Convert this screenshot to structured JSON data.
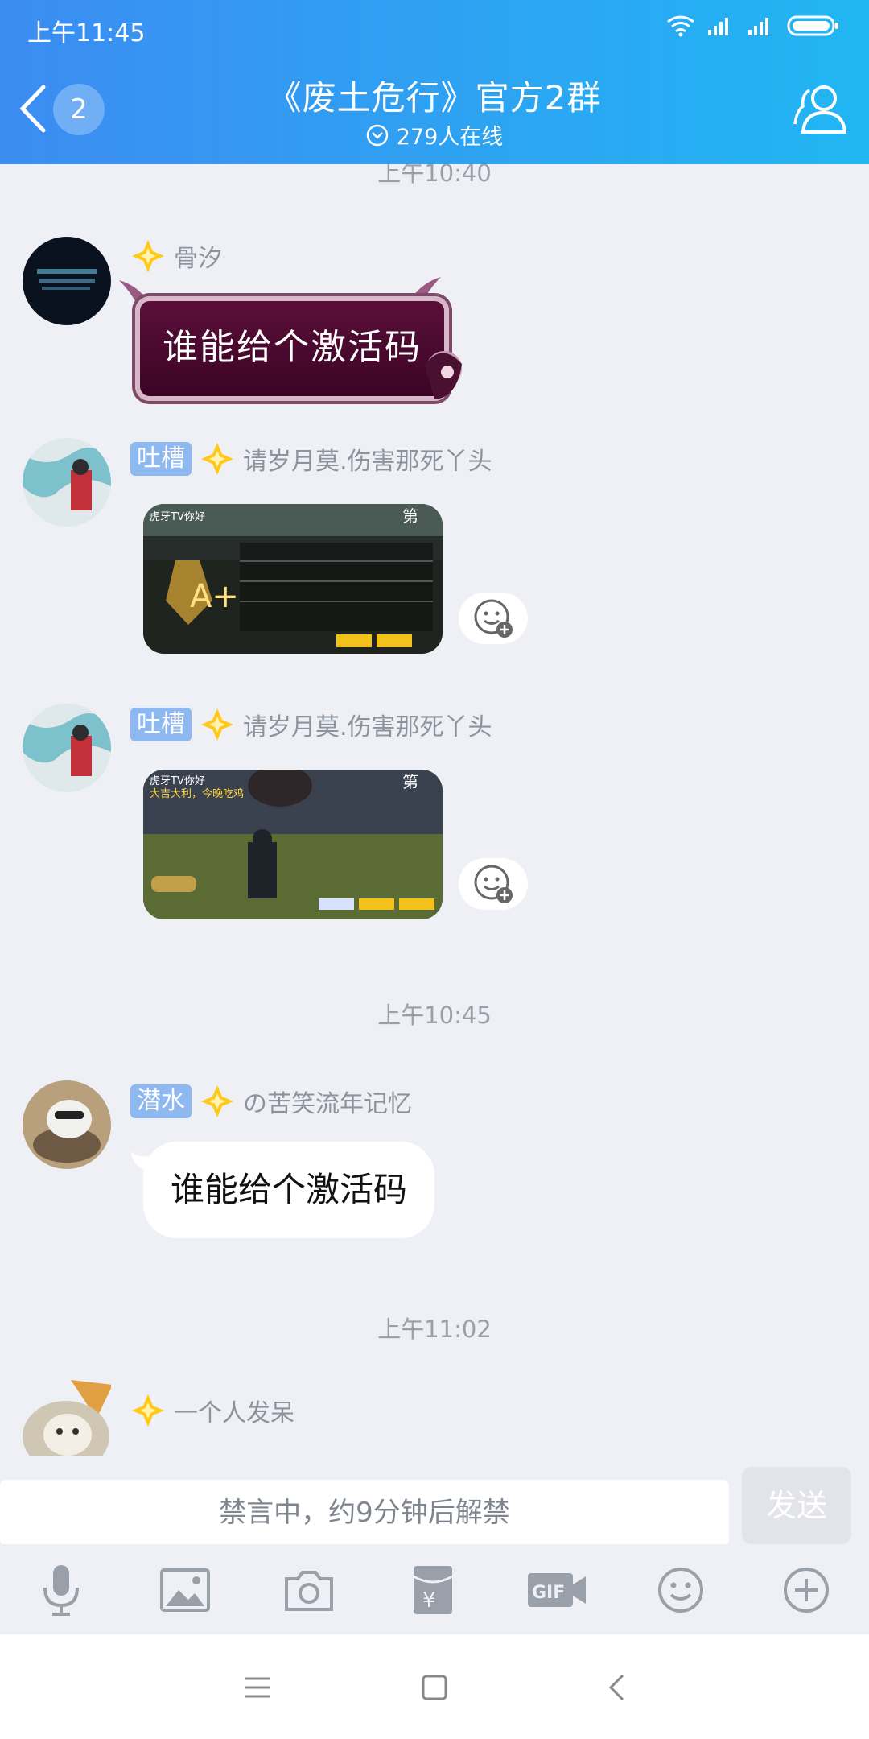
{
  "status": {
    "time": "上午11:45"
  },
  "header": {
    "unread_count": "2",
    "title": "《废土危行》官方2群",
    "online_text": "279人在线"
  },
  "timestamps": [
    "上午10:40",
    "上午10:45",
    "上午11:02"
  ],
  "messages": [
    {
      "sender": "骨汐",
      "badge": "",
      "type": "sticker",
      "text": "谁能给个激活码"
    },
    {
      "sender": "请岁月莫.伤害那死丫头",
      "badge": "吐槽",
      "type": "image",
      "image_caption": "虎牙TV你好"
    },
    {
      "sender": "请岁月莫.伤害那死丫头",
      "badge": "吐槽",
      "type": "image",
      "image_caption": "虎牙TV你好",
      "image_subcaption": "大吉大利，今晚吃鸡"
    },
    {
      "sender": "の苦笑流年记忆",
      "badge": "潜水",
      "type": "text",
      "text": "谁能给个激活码"
    },
    {
      "sender": "一个人发呆",
      "badge": "",
      "type": "partial"
    }
  ],
  "input": {
    "placeholder": "禁言中，约9分钟后解禁",
    "send_label": "发送"
  },
  "toolbar": [
    "mic-icon",
    "image-icon",
    "camera-icon",
    "red-packet-icon",
    "gif-icon",
    "emoji-icon",
    "plus-icon"
  ],
  "colors": {
    "header_start": "#3c8cf2",
    "header_end": "#21b6f3",
    "badge": "#8db8f0",
    "background": "#eef0f6"
  }
}
